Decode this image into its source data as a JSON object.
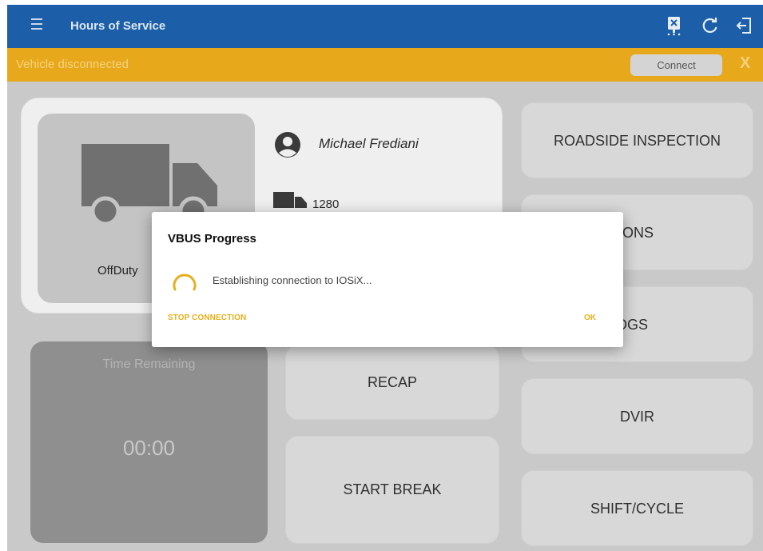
{
  "appbar": {
    "title": "Hours of Service",
    "icons": [
      "menu-icon",
      "eld-device-icon",
      "refresh-icon",
      "logout-icon"
    ]
  },
  "banner": {
    "message": "Vehicle disconnected",
    "connect_label": "Connect",
    "close_label": "X"
  },
  "driver_card": {
    "status": "OffDuty",
    "driver_name": "Michael Frediani",
    "vehicle": "1280"
  },
  "time_remaining": {
    "label": "Time Remaining",
    "value": "00:00"
  },
  "buttons": {
    "recap": "RECAP",
    "start_break": "START BREAK",
    "roadside": "ROADSIDE INSPECTION",
    "violations": "TIONS",
    "logs": "OGS",
    "dvir": "DVIR",
    "shift_cycle": "SHIFT/CYCLE"
  },
  "dialog": {
    "title": "VBUS Progress",
    "message": "Establishing connection to IOSiX...",
    "stop_label": "STOP CONNECTION",
    "ok_label": "OK"
  },
  "colors": {
    "appbar": "#1c5fa8",
    "banner": "#e8a81c",
    "accent": "#e6b11f"
  }
}
